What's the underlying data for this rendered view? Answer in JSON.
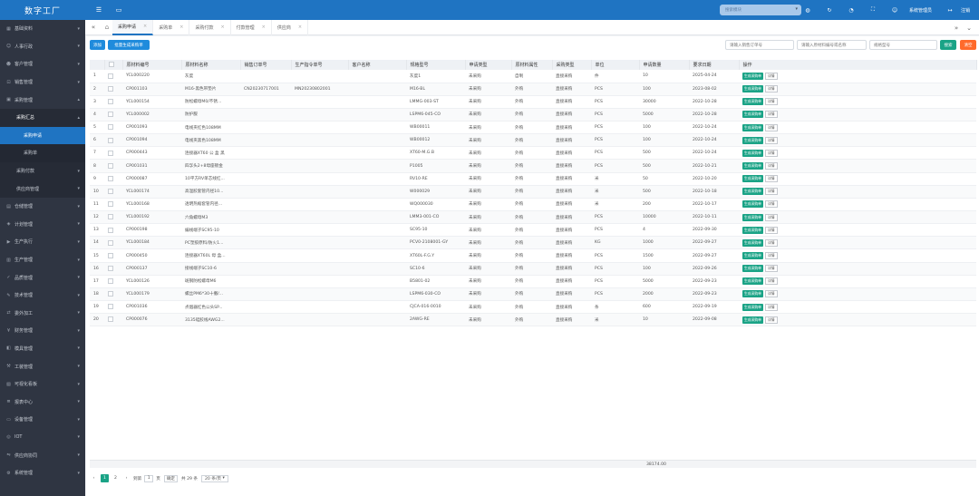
{
  "app": {
    "title": "数字工厂"
  },
  "sidebar": {
    "items": [
      {
        "label": "基础资料",
        "icon": "grid-icon",
        "level": 0
      },
      {
        "label": "人事行政",
        "icon": "person-icon",
        "level": 0
      },
      {
        "label": "客户管理",
        "icon": "users-icon",
        "level": 0
      },
      {
        "label": "销售管理",
        "icon": "cart-icon",
        "level": 0
      },
      {
        "label": "采购管理",
        "icon": "bag-icon",
        "level": 0,
        "expanded": true
      },
      {
        "label": "采购汇总",
        "icon": "",
        "level": 1,
        "expanded": true
      },
      {
        "label": "采购申请",
        "icon": "",
        "level": 2,
        "active": true
      },
      {
        "label": "采购单",
        "icon": "",
        "level": 2
      },
      {
        "label": "采购付款",
        "icon": "",
        "level": 1
      },
      {
        "label": "供应商管理",
        "icon": "",
        "level": 1
      },
      {
        "label": "仓储管理",
        "icon": "box-icon",
        "level": 0
      },
      {
        "label": "计划管理",
        "icon": "plan-icon",
        "level": 0
      },
      {
        "label": "生产执行",
        "icon": "play-icon",
        "level": 0
      },
      {
        "label": "生产管理",
        "icon": "factory-icon",
        "level": 0
      },
      {
        "label": "品质管理",
        "icon": "check-icon",
        "level": 0
      },
      {
        "label": "技术管理",
        "icon": "tool-icon",
        "level": 0
      },
      {
        "label": "委外加工",
        "icon": "share-icon",
        "level": 0
      },
      {
        "label": "财务管理",
        "icon": "money-icon",
        "level": 0
      },
      {
        "label": "模具管理",
        "icon": "mold-icon",
        "level": 0
      },
      {
        "label": "工装管理",
        "icon": "wrench-icon",
        "level": 0
      },
      {
        "label": "可视化看板",
        "icon": "board-icon",
        "level": 0
      },
      {
        "label": "报表中心",
        "icon": "report-icon",
        "level": 0
      },
      {
        "label": "设备管理",
        "icon": "device-icon",
        "level": 0
      },
      {
        "label": "IOT",
        "icon": "iot-icon",
        "level": 0
      },
      {
        "label": "供应商协同",
        "icon": "handshake-icon",
        "level": 0
      },
      {
        "label": "系统管理",
        "icon": "gear-icon",
        "level": 0
      }
    ]
  },
  "topbar": {
    "search_placeholder": "搜索模块",
    "user": "系统管理员",
    "logout": "注销"
  },
  "tabs": [
    {
      "label": "采购申请",
      "active": true
    },
    {
      "label": "采购单",
      "active": false
    },
    {
      "label": "采购付款",
      "active": false
    },
    {
      "label": "付款管理",
      "active": false
    },
    {
      "label": "供应商",
      "active": false
    }
  ],
  "toolbar": {
    "add": "添加",
    "batch": "批量生成采购单",
    "search1": "请输入销售订单号",
    "search2": "请输入原材料编号或名称",
    "search3": "规格型号",
    "search_btn": "搜索",
    "reset_btn": "清空"
  },
  "table": {
    "headers": [
      "原材料编号",
      "原材料名称",
      "销售订单号",
      "生产指令单号",
      "客户名称",
      "规格型号",
      "申请类型",
      "原材料属性",
      "采购类型",
      "单位",
      "申请数量",
      "要求日期",
      "操作"
    ],
    "gen_label": "生成采购单",
    "detail_label": "详情",
    "rows": [
      [
        "1",
        "YCL000220",
        "灰度",
        "",
        "",
        "",
        "灰度1",
        "未采购",
        "自制",
        "直接采购",
        "件",
        "10",
        "2025-04-24"
      ],
      [
        "2",
        "CP001103",
        "M16-黑色带垫片",
        "CN20230717001",
        "MN20230802001",
        "",
        "M16-BL",
        "未采购",
        "外购",
        "直接采购",
        "PCS",
        "100",
        "2023-08-02"
      ],
      [
        "3",
        "YCL000154",
        "防松螺母M0/不锈...",
        "",
        "",
        "",
        "LMMG-003-ST",
        "未采购",
        "外购",
        "直接采购",
        "PCS",
        "30000",
        "2022-10-28"
      ],
      [
        "4",
        "YCL000002",
        "防护服",
        "",
        "",
        "",
        "LSPM6-045-CO",
        "未采购",
        "外购",
        "直接采购",
        "PCS",
        "5000",
        "2022-10-28"
      ],
      [
        "5",
        "CP001093",
        "电线夹红色108MM",
        "",
        "",
        "",
        "WB00011",
        "未采购",
        "外购",
        "直接采购",
        "PCS",
        "100",
        "2022-10-24"
      ],
      [
        "6",
        "CP001094",
        "电线夹黑色108MM",
        "",
        "",
        "",
        "WB00012",
        "未采购",
        "外购",
        "直接采购",
        "PCS",
        "100",
        "2022-10-24"
      ],
      [
        "7",
        "CP000443",
        "连接器XT60 公 盒 黑",
        "",
        "",
        "",
        "XT60-M.G.B",
        "未采购",
        "外购",
        "直接采购",
        "PCS",
        "500",
        "2022-10-24"
      ],
      [
        "8",
        "CP001031",
        "四孚头2+8母座镀金",
        "",
        "",
        "",
        "P1005",
        "未采购",
        "外购",
        "直接采购",
        "PCS",
        "500",
        "2022-10-21"
      ],
      [
        "9",
        "CP000087",
        "10平方RV单芯线红...",
        "",
        "",
        "",
        "RV10-RE",
        "未采购",
        "外购",
        "直接采购",
        "米",
        "50",
        "2022-10-20"
      ],
      [
        "10",
        "YCL000174",
        "高温胶套管内径10...",
        "",
        "",
        "",
        "W000029",
        "未采购",
        "外购",
        "直接采购",
        "米",
        "500",
        "2022-10-18"
      ],
      [
        "11",
        "YCL000168",
        "透明热缩套管内径...",
        "",
        "",
        "",
        "WQ000030",
        "未采购",
        "外购",
        "直接采购",
        "米",
        "200",
        "2022-10-17"
      ],
      [
        "12",
        "YCL000192",
        "六角螺母M3",
        "",
        "",
        "",
        "LMM3-001-CO",
        "未采购",
        "外购",
        "直接采购",
        "PCS",
        "10000",
        "2022-10-11"
      ],
      [
        "13",
        "CP000198",
        "编线端子SC95-10",
        "",
        "",
        "",
        "SC95-10",
        "未采购",
        "外购",
        "直接采购",
        "PCS",
        "4",
        "2022-09-30"
      ],
      [
        "14",
        "YCL000184",
        "PC塑胶原料/防火1...",
        "",
        "",
        "",
        "PCV0-2108001-GY",
        "未采购",
        "外购",
        "直接采购",
        "KG",
        "1000",
        "2022-09-27"
      ],
      [
        "15",
        "CP000450",
        "连接器XT60L 母 盒...",
        "",
        "",
        "",
        "XT60L-F.G.Y",
        "未采购",
        "外购",
        "直接采购",
        "PCS",
        "1500",
        "2022-09-27"
      ],
      [
        "16",
        "CP000137",
        "接线端子SC10-6",
        "",
        "",
        "",
        "SC10-6",
        "未采购",
        "外购",
        "直接采购",
        "PCS",
        "100",
        "2022-09-26"
      ],
      [
        "17",
        "YCL000126",
        "斑钢防松螺母M6",
        "",
        "",
        "",
        "B5801-02",
        "未采购",
        "外购",
        "直接采购",
        "PCS",
        "5000",
        "2022-09-23"
      ],
      [
        "18",
        "YCL000179",
        "螺丝PM6*30十撇/...",
        "",
        "",
        "",
        "LSPM6-030-CO",
        "未采购",
        "外购",
        "直接采购",
        "PCS",
        "2000",
        "2022-09-23"
      ],
      [
        "19",
        "CP001036",
        "点烟器红色公头SP...",
        "",
        "",
        "",
        "CJCA-016-0010",
        "未采购",
        "外购",
        "直接采购",
        "条",
        "600",
        "2022-09-19"
      ],
      [
        "20",
        "CP000076",
        "3135硅胶线AWG2...",
        "",
        "",
        "",
        "2AWG-RE",
        "未采购",
        "外购",
        "直接采购",
        "米",
        "10",
        "2022-09-08"
      ]
    ],
    "total": "38174.00"
  },
  "pager": {
    "pages": [
      "1",
      "2"
    ],
    "current": "1",
    "goto_label": "到第",
    "goto_value": "1",
    "page_unit": "页",
    "confirm": "确定",
    "total_text": "共 29 条",
    "page_size": "20 条/页"
  },
  "colors": {
    "primary": "#1f74c2",
    "sidebar": "#2f3542",
    "green": "#1aa386",
    "orange": "#ff6a2b"
  }
}
